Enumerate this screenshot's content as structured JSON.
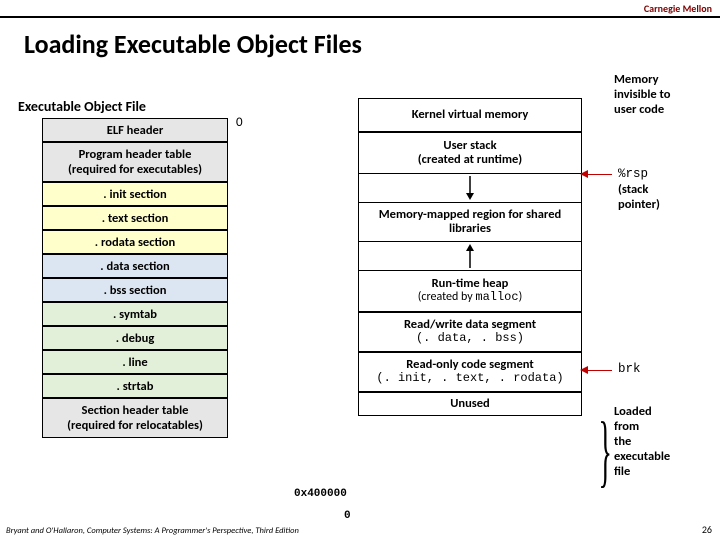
{
  "header": {
    "org": "Carnegie Mellon",
    "title": "Loading Executable Object Files"
  },
  "elf": {
    "title": "Executable Object File",
    "zero": "0",
    "sections": [
      "ELF header",
      "Program header table\n(required for executables)",
      ". init section",
      ". text section",
      ". rodata section",
      ". data section",
      ". bss section",
      ". symtab",
      ". debug",
      ". line",
      ". strtab",
      "Section header table\n(required for relocatables)"
    ]
  },
  "mem": {
    "regions": {
      "kernel": "Kernel virtual memory",
      "stack": "User stack\n(created at runtime)",
      "mmap": "Memory-mapped region for shared libraries",
      "heap_l1": "Run-time heap",
      "heap_l2_pre": "(created by ",
      "heap_l2_code": "malloc",
      "heap_l2_post": ")",
      "rw_l1": "Read/write data segment",
      "rw_l2": "(. data, . bss)",
      "ro_l1": "Read-only code segment",
      "ro_l2": "(. init, . text, . rodata)",
      "unused": "Unused"
    },
    "addr_load": "0x400000",
    "addr_zero": "0"
  },
  "annot": {
    "invisible": "Memory\ninvisible to\nuser code",
    "rsp": "%rsp",
    "rsp_desc": "(stack\npointer)",
    "brk": "brk",
    "loaded": "Loaded\nfrom\nthe\nexecutable\nfile"
  },
  "footer": {
    "cite": "Bryant and O'Hallaron, Computer Systems: A Programmer's Perspective, Third Edition",
    "page": "26"
  }
}
